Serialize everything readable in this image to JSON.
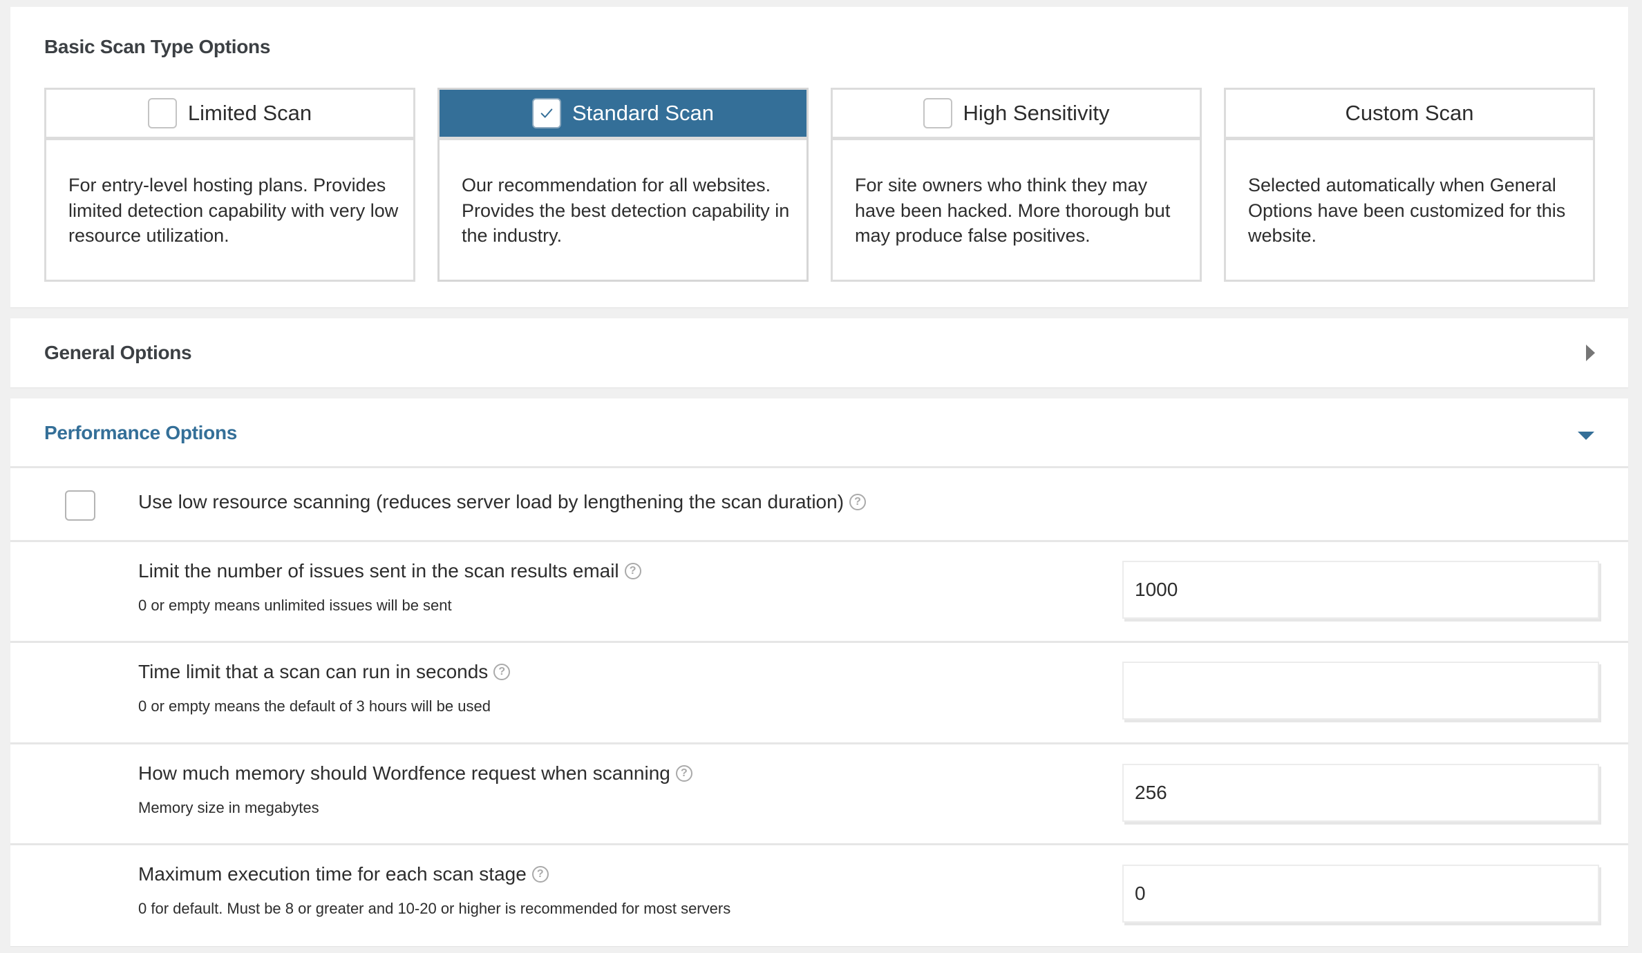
{
  "basic_scan": {
    "title": "Basic Scan Type Options",
    "cards": [
      {
        "label": "Limited Scan",
        "checked": false,
        "description": "For entry-level hosting plans. Provides limited detection capability with very low resource utilization."
      },
      {
        "label": "Standard Scan",
        "checked": true,
        "description": "Our recommendation for all websites. Provides the best detection capability in the industry."
      },
      {
        "label": "High Sensitivity",
        "checked": false,
        "description": "For site owners who think they may have been hacked. More thorough but may produce false positives."
      },
      {
        "label": "Custom Scan",
        "checked": null,
        "description": "Selected automatically when General Options have been customized for this website."
      }
    ],
    "selected_color": "#346f98"
  },
  "general_options": {
    "title": "General Options",
    "state": "collapsed",
    "toggle_icon": "caret-right-icon"
  },
  "performance_options": {
    "title": "Performance Options",
    "state": "expanded",
    "toggle_icon": "caret-down-icon",
    "accent_color": "#346f98",
    "low_resource": {
      "label": "Use low resource scanning (reduces server load by lengthening the scan duration)",
      "checked": false,
      "help_icon": "?"
    },
    "fields": [
      {
        "label": "Limit the number of issues sent in the scan results email",
        "help_icon": "?",
        "sub": "0 or empty means unlimited issues will be sent",
        "value": "1000"
      },
      {
        "label": "Time limit that a scan can run in seconds",
        "help_icon": "?",
        "sub": "0 or empty means the default of 3 hours will be used",
        "value": ""
      },
      {
        "label": "How much memory should Wordfence request when scanning",
        "help_icon": "?",
        "sub": "Memory size in megabytes",
        "value": "256"
      },
      {
        "label": "Maximum execution time for each scan stage",
        "help_icon": "?",
        "sub": "0 for default. Must be 8 or greater and 10-20 or higher is recommended for most servers",
        "value": "0"
      }
    ]
  }
}
